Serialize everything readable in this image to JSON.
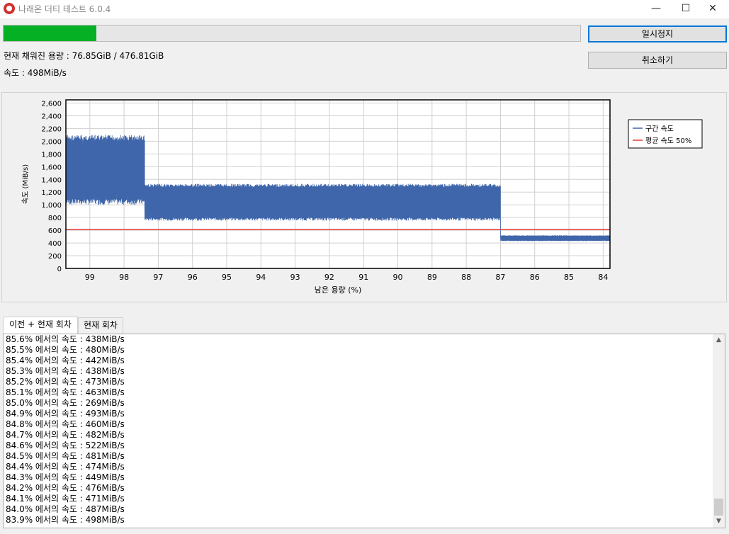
{
  "window": {
    "title": "나래온 더티 테스트 6.0.4",
    "minimize": "—",
    "maximize": "☐",
    "close": "✕"
  },
  "progress": {
    "fraction": 0.1612,
    "color": "#06b025"
  },
  "status": {
    "filled": "현재 채워진 용량 : 76.85GiB / 476.81GiB",
    "speed": "속도 : 498MiB/s"
  },
  "buttons": {
    "pause": "일시정지",
    "cancel": "취소하기"
  },
  "chart_data": {
    "type": "line",
    "xlabel": "남은 용량 (%)",
    "ylabel": "속도 (MiB/s)",
    "xlim": [
      99.7,
      83.8
    ],
    "ylim": [
      0,
      2650
    ],
    "x_ticks": [
      99,
      98,
      97,
      96,
      95,
      94,
      93,
      92,
      91,
      90,
      89,
      88,
      87,
      86,
      85,
      84
    ],
    "y_ticks": [
      0,
      200,
      400,
      600,
      800,
      1000,
      1200,
      1400,
      1600,
      1800,
      2000,
      2200,
      2400,
      2600
    ],
    "y_tick_labels": [
      "0",
      "200",
      "400",
      "600",
      "800",
      "1,000",
      "1,200",
      "1,400",
      "1,600",
      "1,800",
      "2,000",
      "2,200",
      "2,400",
      "2,600"
    ],
    "grid": true,
    "legend_position": "right",
    "series": [
      {
        "name": "구간 속도",
        "color": "#3f66aa",
        "segments": [
          {
            "x_from": 99.7,
            "x_to": 97.4,
            "low": 1000,
            "high": 2100
          },
          {
            "x_from": 97.4,
            "x_to": 87.0,
            "low": 750,
            "high": 1330
          },
          {
            "x_from": 87.0,
            "x_to": 83.8,
            "low": 430,
            "high": 520
          }
        ]
      },
      {
        "name": "평균 속도 50%",
        "color": "#e53935",
        "y": 610
      }
    ]
  },
  "tabs": [
    {
      "label": "이전 + 현재 회차",
      "active": true
    },
    {
      "label": "현재 회차",
      "active": false
    }
  ],
  "log": [
    "85.6% 에서의 속도 : 438MiB/s",
    "85.5% 에서의 속도 : 480MiB/s",
    "85.4% 에서의 속도 : 442MiB/s",
    "85.3% 에서의 속도 : 438MiB/s",
    "85.2% 에서의 속도 : 473MiB/s",
    "85.1% 에서의 속도 : 463MiB/s",
    "85.0% 에서의 속도 : 269MiB/s",
    "84.9% 에서의 속도 : 493MiB/s",
    "84.8% 에서의 속도 : 460MiB/s",
    "84.7% 에서의 속도 : 482MiB/s",
    "84.6% 에서의 속도 : 522MiB/s",
    "84.5% 에서의 속도 : 481MiB/s",
    "84.4% 에서의 속도 : 474MiB/s",
    "84.3% 에서의 속도 : 449MiB/s",
    "84.2% 에서의 속도 : 476MiB/s",
    "84.1% 에서의 속도 : 471MiB/s",
    "84.0% 에서의 속도 : 487MiB/s",
    "83.9% 에서의 속도 : 498MiB/s"
  ],
  "scroll": {
    "up": "▲",
    "down": "▼"
  }
}
